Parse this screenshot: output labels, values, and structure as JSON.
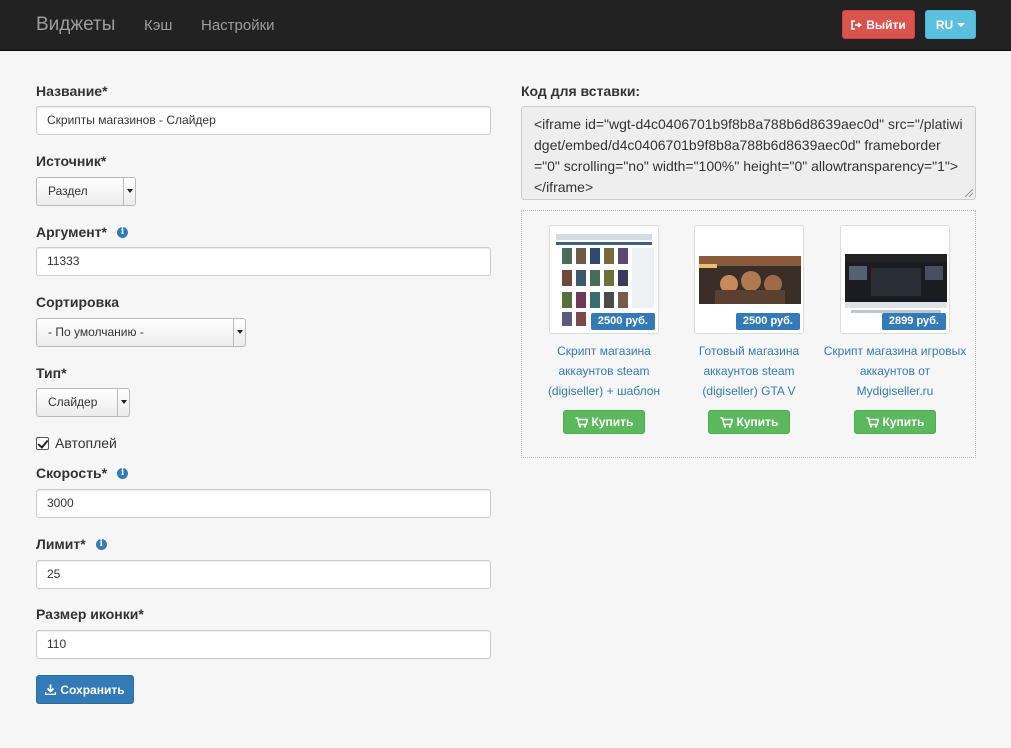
{
  "nav": {
    "brand": "Виджеты",
    "links": [
      {
        "label": "Кэш"
      },
      {
        "label": "Настройки"
      }
    ],
    "logout_label": "Выйти",
    "lang_label": "RU"
  },
  "form": {
    "name": {
      "label": "Название*",
      "value": "Скрипты магазинов - Слайдер"
    },
    "source": {
      "label": "Источник*",
      "selected": "Раздел"
    },
    "argument": {
      "label": "Аргумент*",
      "value": "11333"
    },
    "sort": {
      "label": "Сортировка",
      "selected": "- По умолчанию -"
    },
    "type": {
      "label": "Тип*",
      "selected": "Слайдер"
    },
    "autoplay": {
      "label": "Автоплей",
      "checked": true
    },
    "speed": {
      "label": "Скорость*",
      "value": "3000"
    },
    "limit": {
      "label": "Лимит*",
      "value": "25"
    },
    "icon_size": {
      "label": "Размер иконки*",
      "value": "110"
    },
    "save_label": "Сохранить"
  },
  "embed": {
    "label": "Код для вставки:",
    "code": "<iframe id=\"wgt-d4c0406701b9f8b8a788b6d8639aec0d\" src=\"/platiwidget/embed/d4c0406701b9f8b8a788b6d8639aec0d\" frameborder=\"0\" scrolling=\"no\" width=\"100%\" height=\"0\" allowtransparency=\"1\"></iframe>"
  },
  "products": [
    {
      "price": "2500 руб.",
      "title": "Скрипт магазина аккаунтов steam (digiseller) + шаблон",
      "buy_label": "Купить"
    },
    {
      "price": "2500 руб.",
      "title": "Готовый магазина аккаунтов steam (digiseller) GTA V",
      "buy_label": "Купить"
    },
    {
      "price": "2899 руб.",
      "title": "Скрипт магазина игровых аккаунтов от Mydigiseller.ru",
      "buy_label": "Купить"
    }
  ],
  "colors": {
    "navbar": "#222222",
    "danger": "#d9534f",
    "info": "#5bc0de",
    "primary": "#337ab7",
    "success": "#5cb85c"
  }
}
